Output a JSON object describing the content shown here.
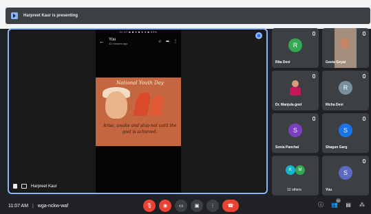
{
  "presenting": {
    "text": "Harpreet Kaur is presenting"
  },
  "main": {
    "presenter_name": "Harpreet Kaur",
    "phone": {
      "status": "11:07 ■ ■ ● ■ ● ● ■ 92%",
      "sender": "You",
      "time_ago": "42 minutes ago",
      "poster_title": "National Youth Day",
      "poster_text": "Arise, awake and stop not until the goal is achieved."
    }
  },
  "participants": [
    {
      "name": "Rita Devi",
      "initial": "R",
      "color": "#34a853"
    },
    {
      "name": "Geeta Goyal"
    },
    {
      "name": "Dr. Manjula goel"
    },
    {
      "name": "Richa Devi",
      "initial": "R",
      "color": "#78909c"
    },
    {
      "name": "Sonia Panchal",
      "initial": "S",
      "color": "#7b3fbf"
    },
    {
      "name": "Shagun Garg",
      "initial": "S",
      "color": "#1a73e8"
    },
    {
      "name": "12 others",
      "initials": [
        "K",
        "M"
      ],
      "colors": [
        "#12b5cb",
        "#34a853"
      ]
    },
    {
      "name": "You",
      "initial": "S",
      "color": "#5c6bc0"
    }
  ],
  "bottom": {
    "time": "11:07 AM",
    "separator": "|",
    "meeting_code": "wga-nckw-waf",
    "participant_count": "20"
  }
}
